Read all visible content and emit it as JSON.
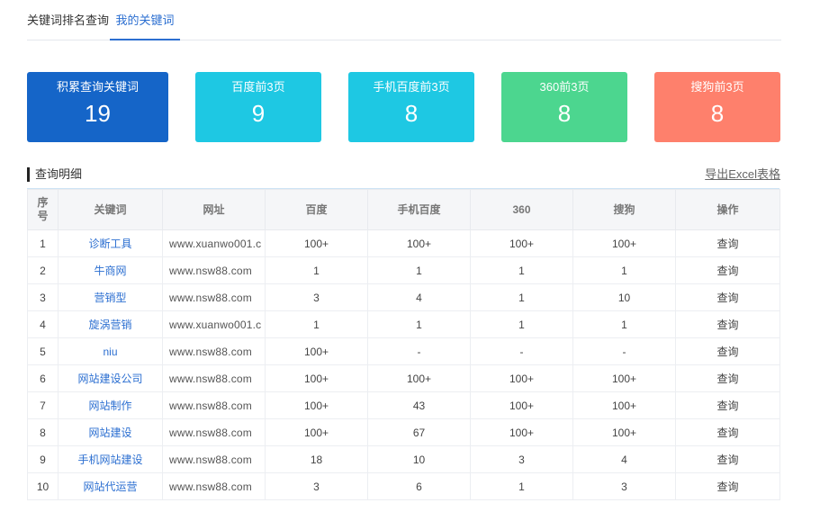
{
  "tabs": [
    "关键词排名查询",
    "我的关键词"
  ],
  "cards": [
    {
      "label": "积累查询关键词",
      "value": "19",
      "color": "#1565c8"
    },
    {
      "label": "百度前3页",
      "value": "9",
      "color": "#1ec8e3"
    },
    {
      "label": "手机百度前3页",
      "value": "8",
      "color": "#1ec8e3"
    },
    {
      "label": "360前3页",
      "value": "8",
      "color": "#4cd68f"
    },
    {
      "label": "搜狗前3页",
      "value": "8",
      "color": "#fe806c"
    }
  ],
  "section": {
    "title": "查询明细",
    "export_label": "导出Excel表格"
  },
  "table": {
    "headers": [
      "序号",
      "关键词",
      "网址",
      "百度",
      "手机百度",
      "360",
      "搜狗",
      "操作"
    ],
    "rows": [
      {
        "no": "1",
        "keyword": "诊断工具",
        "url": "www.xuanwo001.c",
        "baidu": "100+",
        "mbaidu": "100+",
        "s360": "100+",
        "sogou": "100+",
        "action": "查询"
      },
      {
        "no": "2",
        "keyword": "牛商网",
        "url": "www.nsw88.com",
        "baidu": "1",
        "mbaidu": "1",
        "s360": "1",
        "sogou": "1",
        "action": "查询"
      },
      {
        "no": "3",
        "keyword": "营销型",
        "url": "www.nsw88.com",
        "baidu": "3",
        "mbaidu": "4",
        "s360": "1",
        "sogou": "10",
        "action": "查询"
      },
      {
        "no": "4",
        "keyword": "旋涡营销",
        "url": "www.xuanwo001.c",
        "baidu": "1",
        "mbaidu": "1",
        "s360": "1",
        "sogou": "1",
        "action": "查询"
      },
      {
        "no": "5",
        "keyword": "niu",
        "url": "www.nsw88.com",
        "baidu": "100+",
        "mbaidu": "-",
        "s360": "-",
        "sogou": "-",
        "action": "查询"
      },
      {
        "no": "6",
        "keyword": "网站建设公司",
        "url": "www.nsw88.com",
        "baidu": "100+",
        "mbaidu": "100+",
        "s360": "100+",
        "sogou": "100+",
        "action": "查询"
      },
      {
        "no": "7",
        "keyword": "网站制作",
        "url": "www.nsw88.com",
        "baidu": "100+",
        "mbaidu": "43",
        "s360": "100+",
        "sogou": "100+",
        "action": "查询"
      },
      {
        "no": "8",
        "keyword": "网站建设",
        "url": "www.nsw88.com",
        "baidu": "100+",
        "mbaidu": "67",
        "s360": "100+",
        "sogou": "100+",
        "action": "查询"
      },
      {
        "no": "9",
        "keyword": "手机网站建设",
        "url": "www.nsw88.com",
        "baidu": "18",
        "mbaidu": "10",
        "s360": "3",
        "sogou": "4",
        "action": "查询"
      },
      {
        "no": "10",
        "keyword": "网站代运营",
        "url": "www.nsw88.com",
        "baidu": "3",
        "mbaidu": "6",
        "s360": "1",
        "sogou": "3",
        "action": "查询"
      }
    ]
  }
}
